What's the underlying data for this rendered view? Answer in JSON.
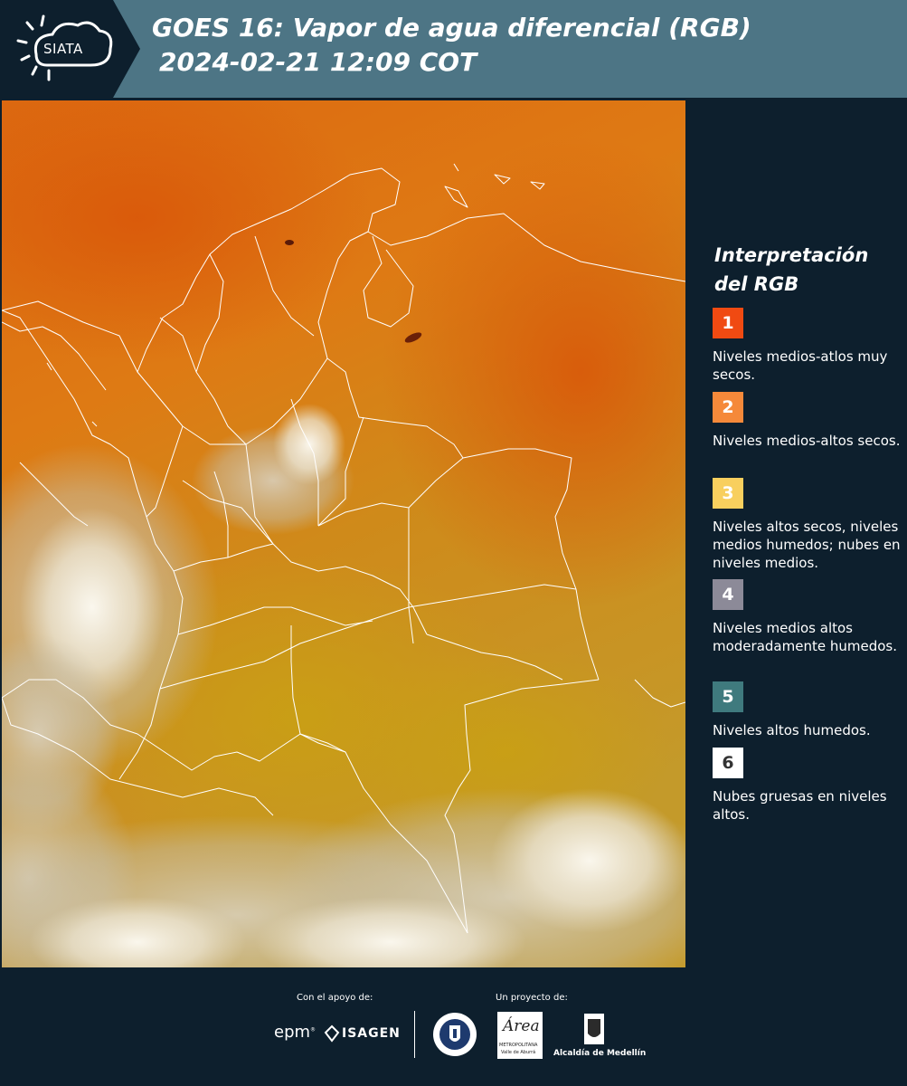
{
  "header": {
    "logo_text": "SIATA",
    "title_line1": "GOES 16: Vapor de agua diferencial (RGB)",
    "title_line2": "2024-02-21 12:09 COT"
  },
  "legend": {
    "title": "Interpretación del RGB",
    "items": [
      {
        "number": "1",
        "color": "#f04a12",
        "text_color": "#ffffff",
        "description": "Niveles medios-atlos muy secos."
      },
      {
        "number": "2",
        "color": "#f5893a",
        "text_color": "#ffffff",
        "description": "Niveles medios-altos secos."
      },
      {
        "number": "3",
        "color": "#f8cf5e",
        "text_color": "#ffffff",
        "description": "Niveles altos secos, niveles medios humedos; nubes en niveles medios."
      },
      {
        "number": "4",
        "color": "#8c8a98",
        "text_color": "#ffffff",
        "description": "Niveles medios altos moderadamente humedos."
      },
      {
        "number": "5",
        "color": "#3f7a7e",
        "text_color": "#ffffff",
        "description": "Niveles altos humedos."
      },
      {
        "number": "6",
        "color": "#ffffff",
        "text_color": "#333333",
        "description": "Nubes gruesas en niveles altos."
      }
    ]
  },
  "footer": {
    "support_label": "Con el apoyo de:",
    "project_label": "Un proyecto de:",
    "epm_logo": "epm",
    "isagen_logo": "ISAGEN",
    "area_logo": "Área",
    "area_sub": "METROPOLITANA",
    "area_sub2": "Valle de Aburrá",
    "alcaldia_logo": "Alcaldía de Medellín"
  },
  "colors": {
    "header_bg": "#4d7585",
    "panel_bg": "#0d1f2d",
    "map_dry": "#dd6a10",
    "map_moist": "#c9a226",
    "map_cloud": "#f3f1ea"
  },
  "icons": [
    "sun-cloud-logo-icon",
    "epm-logo",
    "isagen-logo",
    "medellin-seal-logo",
    "area-metropolitana-logo",
    "alcaldia-medellin-logo"
  ]
}
